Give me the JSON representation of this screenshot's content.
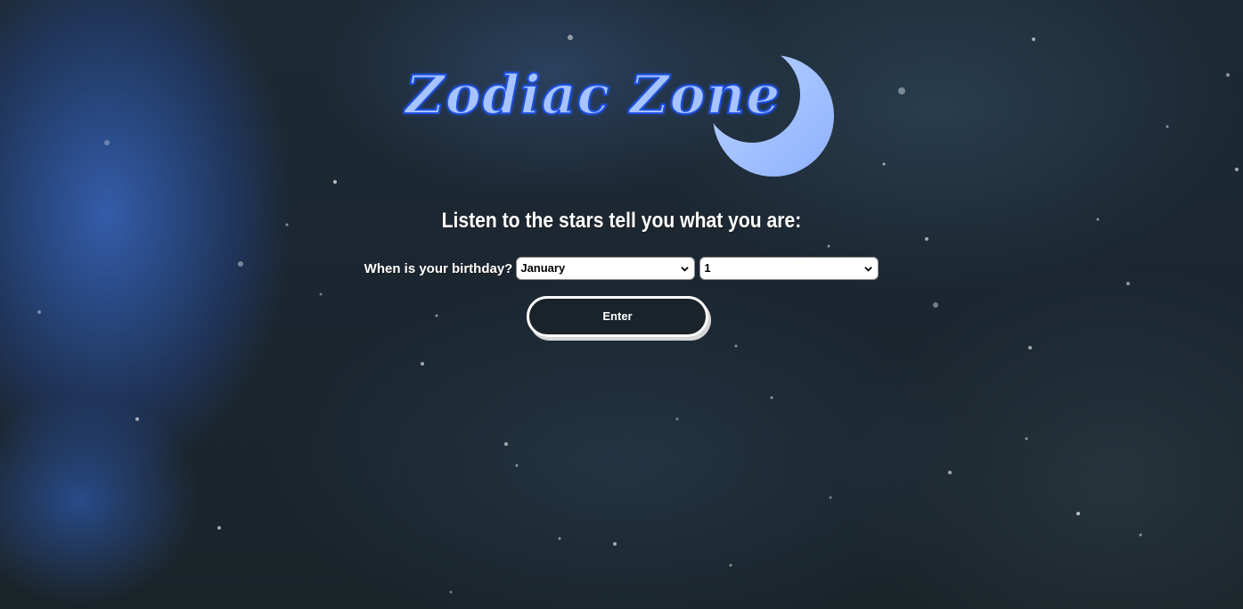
{
  "header": {
    "title": "Zodiac Zone",
    "moon_icon": "crescent-moon-icon"
  },
  "main": {
    "tagline": "Listen to the stars tell you what you are:",
    "birthday_label": "When is your birthday?",
    "month_select": {
      "value": "January",
      "icon": "chevron-down-icon"
    },
    "day_select": {
      "value": "1",
      "icon": "chevron-down-icon"
    },
    "enter_label": "Enter"
  },
  "colors": {
    "title_fill": "#a7c4ff",
    "title_stroke": "#1d4fe0",
    "moon": "#9fbfff",
    "background": "#1b2630"
  }
}
